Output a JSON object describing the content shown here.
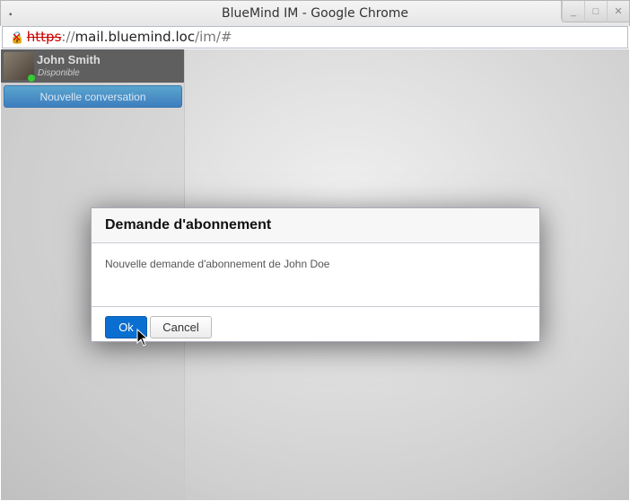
{
  "window": {
    "title": "BlueMind IM - Google Chrome",
    "minimize": "_",
    "maximize": "□",
    "close": "✕"
  },
  "address": {
    "scheme": "https",
    "sep": "://",
    "host": "mail.bluemind.loc",
    "path": "/im/#"
  },
  "user": {
    "name": "John Smith",
    "status": "Disponible",
    "status_color": "#33cc33"
  },
  "sidebar": {
    "new_conversation": "Nouvelle conversation"
  },
  "dialog": {
    "title": "Demande d'abonnement",
    "message": "Nouvelle demande d'abonnement de John Doe",
    "ok": "Ok",
    "cancel": "Cancel"
  }
}
